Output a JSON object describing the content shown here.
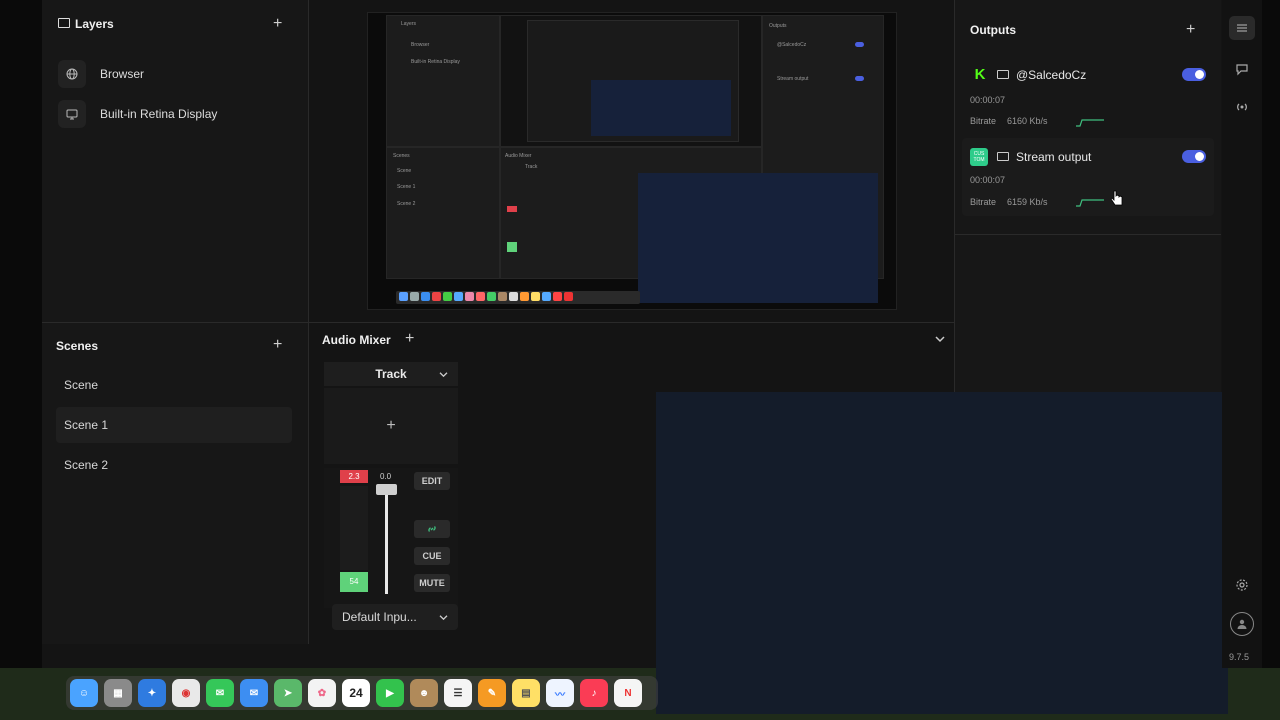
{
  "layers": {
    "title": "Layers",
    "items": [
      {
        "label": "Browser",
        "icon": "globe-icon"
      },
      {
        "label": "Built-in Retina Display",
        "icon": "monitor-icon"
      }
    ]
  },
  "scenes": {
    "title": "Scenes",
    "items": [
      {
        "label": "Scene",
        "active": false
      },
      {
        "label": "Scene 1",
        "active": true
      },
      {
        "label": "Scene 2",
        "active": false
      }
    ]
  },
  "audio_mixer": {
    "title": "Audio Mixer",
    "track_label": "Track",
    "peak_value": "2.3",
    "fader_value": "0.0",
    "level_value": "54",
    "buttons": {
      "edit": "EDIT",
      "cue": "CUE",
      "mute": "MUTE"
    },
    "input_select": "Default Inpu..."
  },
  "outputs": {
    "title": "Outputs",
    "items": [
      {
        "name": "@SalcedoCz",
        "time": "00:00:07",
        "bitrate_label": "Bitrate",
        "bitrate_value": "6160 Kb/s",
        "enabled": true,
        "logo": "kick-logo-icon"
      },
      {
        "name": "Stream output",
        "time": "00:00:07",
        "bitrate_label": "Bitrate",
        "bitrate_value": "6159 Kb/s",
        "enabled": true,
        "logo": "custom-logo-icon",
        "logo_text": "CUS TOM"
      }
    ]
  },
  "version": "9.7.5",
  "preview_mini": {
    "layers_title": "Layers",
    "layer1": "Browser",
    "layer2": "Built-in Retina Display",
    "scenes_title": "Scenes",
    "scene_a": "Scene",
    "scene_b": "Scene 1",
    "scene_c": "Scene 2",
    "mixer_title": "Audio Mixer",
    "track": "Track",
    "outputs_title": "Outputs",
    "out1": "@SalcedoCz",
    "out2": "Stream output"
  },
  "dock": {
    "calendar_day": "24"
  },
  "colors": {
    "accent": "#4a5fe0",
    "kick_green": "#53fc18",
    "meter_red": "#e0404a",
    "meter_green": "#5fd27a",
    "link_green": "#3fbf7f"
  }
}
